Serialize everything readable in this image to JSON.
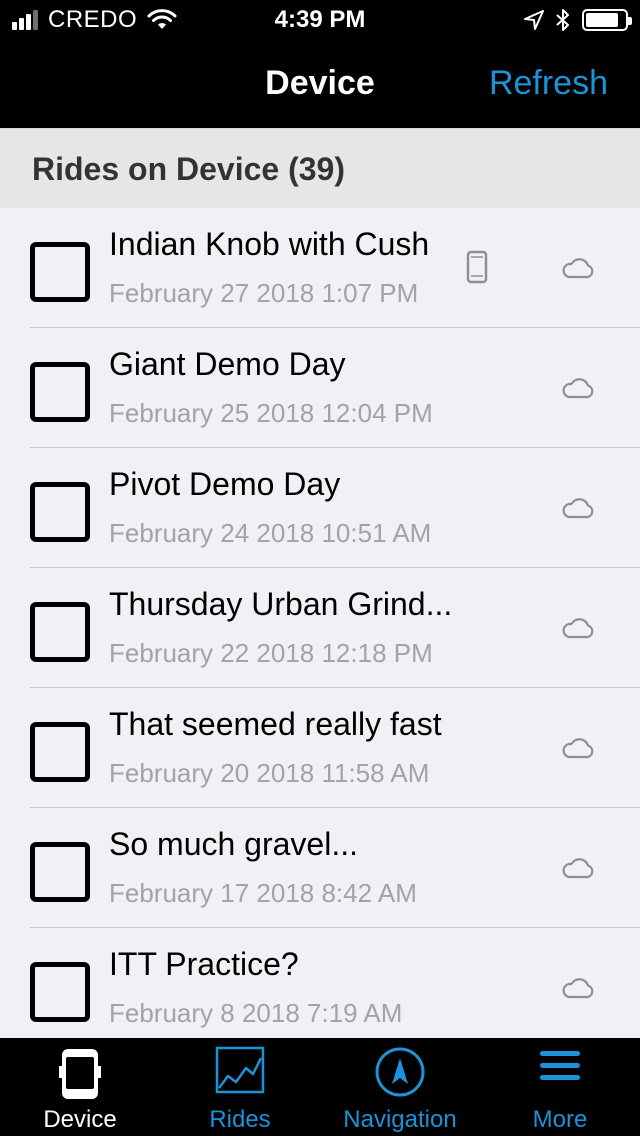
{
  "status_bar": {
    "carrier": "CREDO",
    "time": "4:39 PM"
  },
  "nav": {
    "title": "Device",
    "refresh_label": "Refresh"
  },
  "section": {
    "title": "Rides on Device (39)"
  },
  "rides": [
    {
      "title": "Indian Knob with Cush",
      "date": "February 27 2018 1:07 PM",
      "on_device": true
    },
    {
      "title": "Giant Demo Day",
      "date": "February 25 2018 12:04 PM",
      "on_device": false
    },
    {
      "title": "Pivot Demo Day",
      "date": "February 24 2018 10:51 AM",
      "on_device": false
    },
    {
      "title": "Thursday Urban Grind...",
      "date": "February 22 2018 12:18 PM",
      "on_device": false
    },
    {
      "title": "That seemed really fast",
      "date": "February 20 2018 11:58 AM",
      "on_device": false
    },
    {
      "title": "So much gravel...",
      "date": "February 17 2018 8:42 AM",
      "on_device": false
    },
    {
      "title": "ITT Practice?",
      "date": "February 8 2018 7:19 AM",
      "on_device": false
    }
  ],
  "tabs": [
    {
      "label": "Device",
      "icon": "device-icon",
      "active": true
    },
    {
      "label": "Rides",
      "icon": "chart-icon",
      "active": false
    },
    {
      "label": "Navigation",
      "icon": "compass-icon",
      "active": false
    },
    {
      "label": "More",
      "icon": "menu-icon",
      "active": false
    }
  ],
  "colors": {
    "accent": "#1a93d8",
    "bar_background": "#000000",
    "list_background": "#f0f0f5",
    "secondary_text": "#a2a2a8",
    "active_tab": "#ffffff"
  }
}
